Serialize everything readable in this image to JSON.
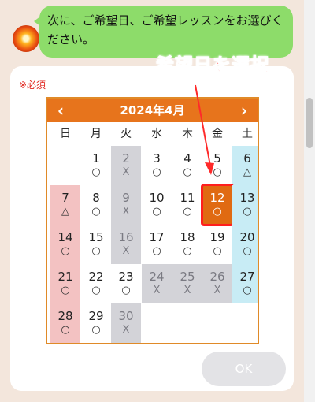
{
  "chat": {
    "message": "次に、ご希望日、ご希望レッスンをお選びください。"
  },
  "form": {
    "required_label": "※必須",
    "ok_label": "OK"
  },
  "annotation": {
    "text": "希望日を選択",
    "color": "#ff2a2a"
  },
  "calendar": {
    "title": "2024年4月",
    "prev_icon": "‹",
    "next_icon": "›",
    "weekdays": [
      "日",
      "月",
      "火",
      "水",
      "木",
      "金",
      "土"
    ],
    "selected_day": "12",
    "weeks": [
      [
        {
          "day": "",
          "mark": "",
          "status": "empty"
        },
        {
          "day": "1",
          "mark": "○",
          "status": "available"
        },
        {
          "day": "2",
          "mark": "X",
          "status": "closed"
        },
        {
          "day": "3",
          "mark": "○",
          "status": "available"
        },
        {
          "day": "4",
          "mark": "○",
          "status": "available"
        },
        {
          "day": "5",
          "mark": "○",
          "status": "available"
        },
        {
          "day": "6",
          "mark": "△",
          "status": "few"
        }
      ],
      [
        {
          "day": "7",
          "mark": "△",
          "status": "few"
        },
        {
          "day": "8",
          "mark": "○",
          "status": "available"
        },
        {
          "day": "9",
          "mark": "X",
          "status": "closed"
        },
        {
          "day": "10",
          "mark": "○",
          "status": "available"
        },
        {
          "day": "11",
          "mark": "○",
          "status": "available"
        },
        {
          "day": "12",
          "mark": "○",
          "status": "selected"
        },
        {
          "day": "13",
          "mark": "○",
          "status": "available"
        }
      ],
      [
        {
          "day": "14",
          "mark": "○",
          "status": "available"
        },
        {
          "day": "15",
          "mark": "○",
          "status": "available"
        },
        {
          "day": "16",
          "mark": "X",
          "status": "closed"
        },
        {
          "day": "17",
          "mark": "○",
          "status": "available"
        },
        {
          "day": "18",
          "mark": "○",
          "status": "available"
        },
        {
          "day": "19",
          "mark": "○",
          "status": "available"
        },
        {
          "day": "20",
          "mark": "○",
          "status": "available"
        }
      ],
      [
        {
          "day": "21",
          "mark": "○",
          "status": "available"
        },
        {
          "day": "22",
          "mark": "○",
          "status": "available"
        },
        {
          "day": "23",
          "mark": "○",
          "status": "available"
        },
        {
          "day": "24",
          "mark": "X",
          "status": "closed"
        },
        {
          "day": "25",
          "mark": "X",
          "status": "closed"
        },
        {
          "day": "26",
          "mark": "X",
          "status": "closed"
        },
        {
          "day": "27",
          "mark": "○",
          "status": "available"
        }
      ],
      [
        {
          "day": "28",
          "mark": "○",
          "status": "available"
        },
        {
          "day": "29",
          "mark": "○",
          "status": "available"
        },
        {
          "day": "30",
          "mark": "X",
          "status": "closed"
        },
        {
          "day": "",
          "mark": "",
          "status": "empty"
        },
        {
          "day": "",
          "mark": "",
          "status": "empty"
        },
        {
          "day": "",
          "mark": "",
          "status": "empty"
        },
        {
          "day": "",
          "mark": "",
          "status": "empty"
        }
      ]
    ]
  },
  "colors": {
    "header": "#e7741c",
    "bubble": "#8ddc6a",
    "closed": "#d3d3d8",
    "sunday": "#f3c2c2",
    "saturday": "#c8ecf5",
    "selected": "#e06a12"
  }
}
